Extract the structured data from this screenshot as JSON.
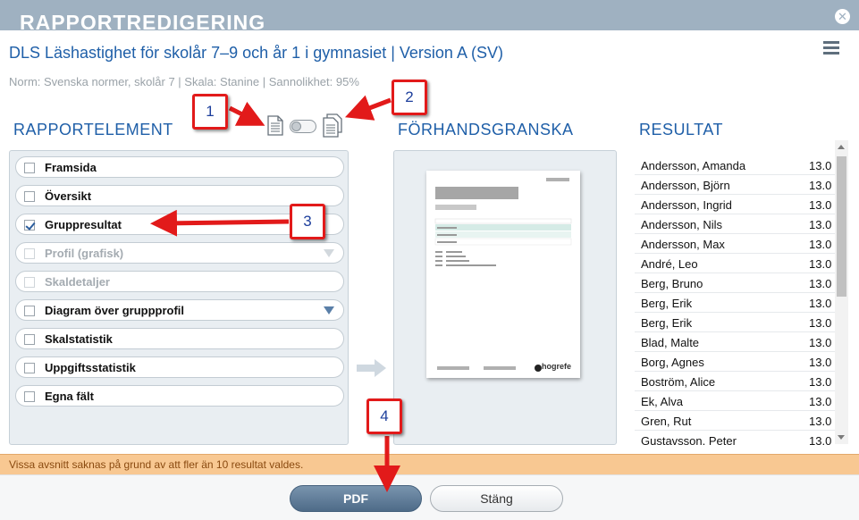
{
  "dialog": {
    "title": "RAPPORTREDIGERING",
    "report_title": "DLS Läshastighet för skolår 7–9 och år 1 i gymnasiet | Version A (SV)",
    "meta": "Norm: Svenska normer, skolår 7 | Skala: Stanine | Sannolikhet: 95%"
  },
  "sections": {
    "elements": "RAPPORTELEMENT",
    "preview": "FÖRHANDSGRANSKA",
    "results": "RESULTAT"
  },
  "report_elements": [
    {
      "label": "Framsida",
      "checked": false,
      "enabled": true,
      "dropdown": false
    },
    {
      "label": "Översikt",
      "checked": false,
      "enabled": true,
      "dropdown": false
    },
    {
      "label": "Gruppresultat",
      "checked": true,
      "enabled": true,
      "dropdown": false
    },
    {
      "label": "Profil (grafisk)",
      "checked": false,
      "enabled": false,
      "dropdown": true
    },
    {
      "label": "Skaldetaljer",
      "checked": false,
      "enabled": false,
      "dropdown": false
    },
    {
      "label": "Diagram över gruppprofil",
      "checked": false,
      "enabled": true,
      "dropdown": true
    },
    {
      "label": "Skalstatistik",
      "checked": false,
      "enabled": true,
      "dropdown": false
    },
    {
      "label": "Uppgiftsstatistik",
      "checked": false,
      "enabled": true,
      "dropdown": false
    },
    {
      "label": "Egna fält",
      "checked": false,
      "enabled": true,
      "dropdown": false
    }
  ],
  "preview": {
    "logo": "hogrefe"
  },
  "results": [
    {
      "name": "Andersson, Amanda",
      "date": "13.0"
    },
    {
      "name": "Andersson, Björn",
      "date": "13.0"
    },
    {
      "name": "Andersson, Ingrid",
      "date": "13.0"
    },
    {
      "name": "Andersson, Nils",
      "date": "13.0"
    },
    {
      "name": "Andersson, Max",
      "date": "13.0"
    },
    {
      "name": "André, Leo",
      "date": "13.0"
    },
    {
      "name": "Berg, Bruno",
      "date": "13.0"
    },
    {
      "name": "Berg, Erik",
      "date": "13.0"
    },
    {
      "name": "Berg, Erik",
      "date": "13.0"
    },
    {
      "name": "Blad, Malte",
      "date": "13.0"
    },
    {
      "name": "Borg, Agnes",
      "date": "13.0"
    },
    {
      "name": "Boström, Alice",
      "date": "13.0"
    },
    {
      "name": "Ek, Alva",
      "date": "13.0"
    },
    {
      "name": "Gren, Rut",
      "date": "13.0"
    },
    {
      "name": "Gustavsson, Peter",
      "date": "13.0"
    }
  ],
  "warning": "Vissa avsnitt saknas på grund av att fler än 10 resultat valdes.",
  "buttons": {
    "pdf": "PDF",
    "close": "Stäng"
  },
  "callouts": [
    "1",
    "2",
    "3",
    "4"
  ],
  "icons": {
    "close": "close-icon",
    "menu": "menu-icon",
    "single_report": "single-document-icon",
    "multi_report": "multi-document-icon"
  },
  "colors": {
    "title_bar": "#9fb1c1",
    "accent_blue": "#1f5fa8",
    "warning_bg": "#f8c892",
    "callout_border": "#e21a1a"
  }
}
